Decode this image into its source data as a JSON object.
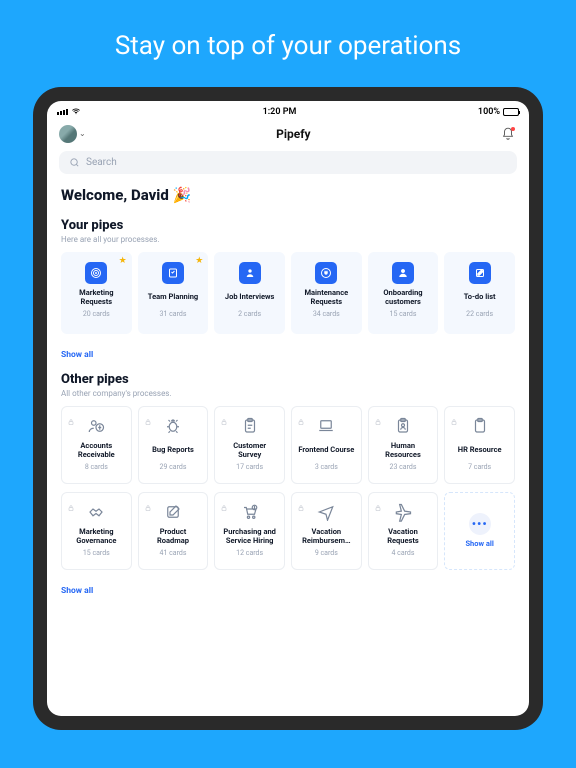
{
  "hero": "Stay on top of your operations",
  "status": {
    "time": "1:20 PM",
    "battery": "100%"
  },
  "nav": {
    "title": "Pipefy"
  },
  "search": {
    "placeholder": "Search"
  },
  "welcome": "Welcome, David 🎉",
  "your_pipes": {
    "title": "Your pipes",
    "subtitle": "Here are all your processes.",
    "show_all": "Show all",
    "items": [
      {
        "title": "Marketing Requests",
        "cards": "20 cards",
        "starred": true
      },
      {
        "title": "Team Planning",
        "cards": "31 cards",
        "starred": true
      },
      {
        "title": "Job Interviews",
        "cards": "2 cards",
        "starred": false
      },
      {
        "title": "Maintenance Requests",
        "cards": "34 cards",
        "starred": false
      },
      {
        "title": "Onboarding customers",
        "cards": "15 cards",
        "starred": false
      },
      {
        "title": "To-do list",
        "cards": "22 cards",
        "starred": false
      }
    ]
  },
  "other_pipes": {
    "title": "Other pipes",
    "subtitle": "All other company's processes.",
    "show_all": "Show all",
    "ghost_label": "Show all",
    "items": [
      {
        "title": "Accounts Receivable",
        "cards": "8 cards"
      },
      {
        "title": "Bug Reports",
        "cards": "29 cards"
      },
      {
        "title": "Customer Survey",
        "cards": "17 cards"
      },
      {
        "title": "Frontend Course",
        "cards": "3 cards"
      },
      {
        "title": "Human Resources",
        "cards": "23 cards"
      },
      {
        "title": "HR Resource",
        "cards": "7 cards"
      },
      {
        "title": "Marketing Governance",
        "cards": "15 cards"
      },
      {
        "title": "Product Roadmap",
        "cards": "41 cards"
      },
      {
        "title": "Purchasing and Service Hiring",
        "cards": "12 cards"
      },
      {
        "title": "Vacation Reimbursem…",
        "cards": "9 cards"
      },
      {
        "title": "Vacation Requests",
        "cards": "4 cards"
      }
    ]
  }
}
